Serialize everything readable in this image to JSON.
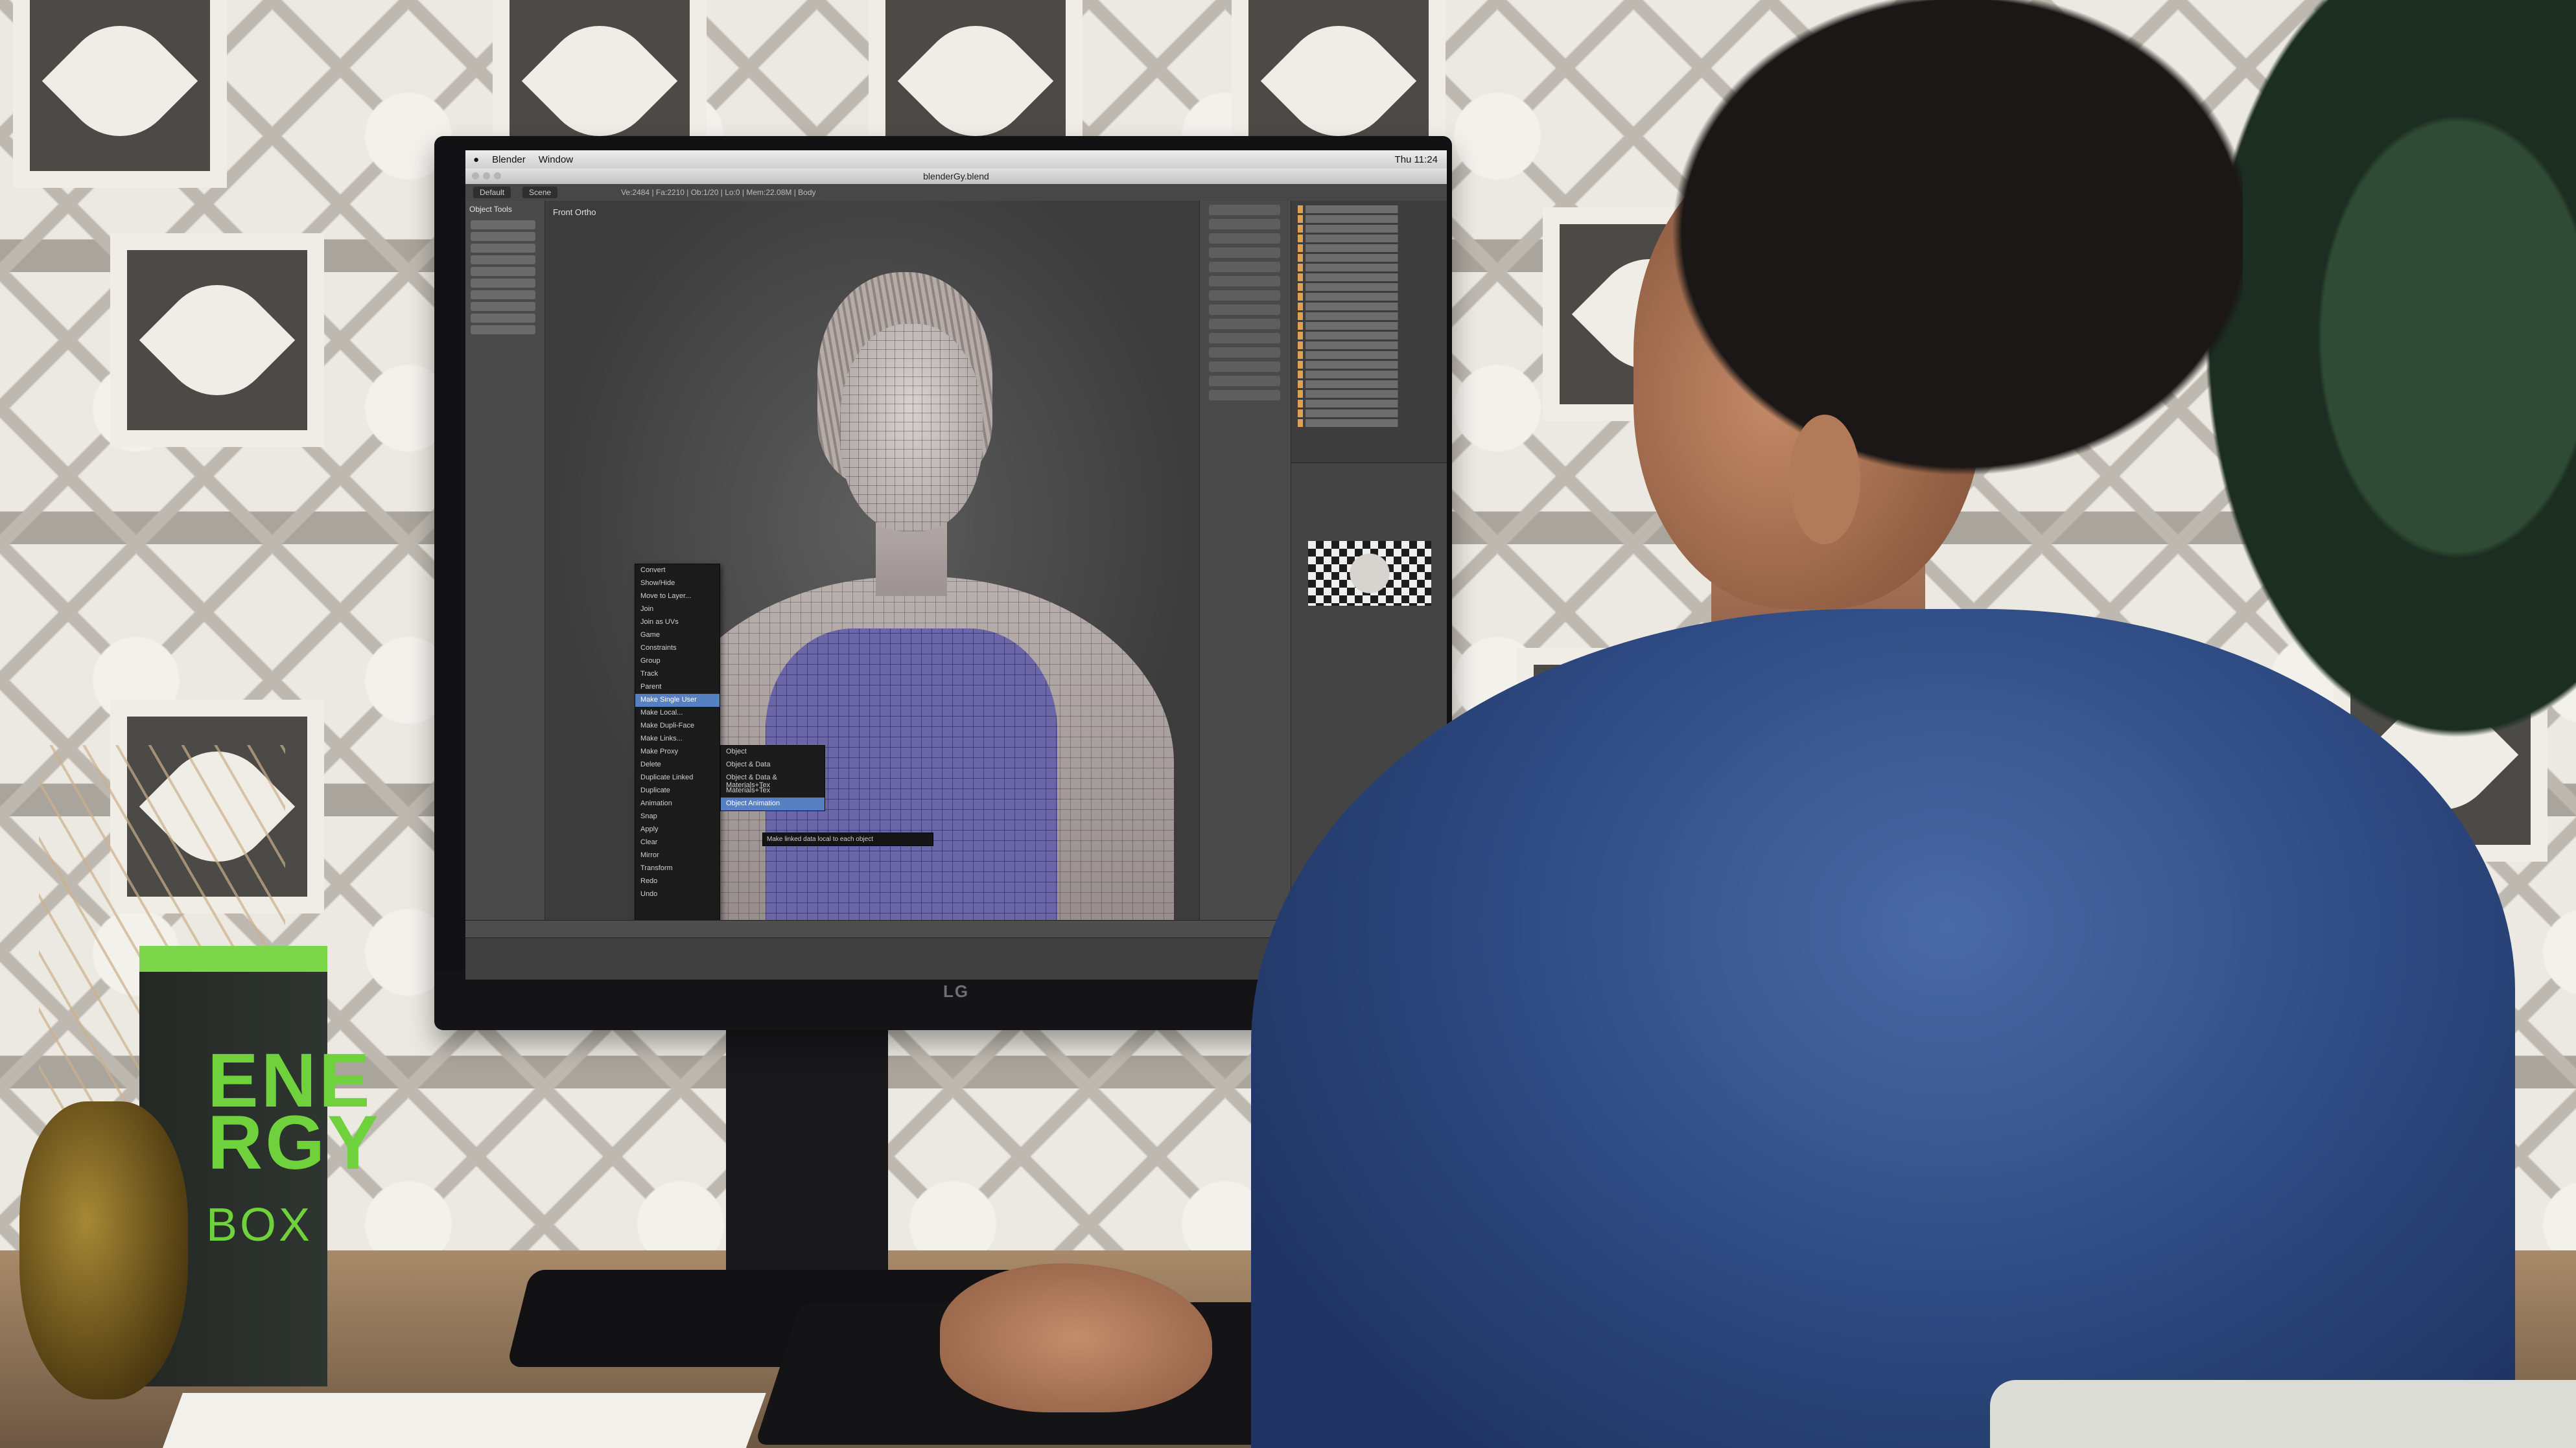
{
  "scene": {
    "description_label": "",
    "monitor": {
      "brand": "LG"
    },
    "product_box": {
      "line1": "ENE",
      "line2": "RGY",
      "line3": "BOX"
    }
  },
  "screen": {
    "menubar": {
      "apple": "",
      "app": "Blender",
      "window": "Window",
      "clock": "Thu 11:24"
    },
    "titlebar": {
      "title": "blenderGy.blend"
    },
    "info_header": {
      "layout": "Default",
      "scene": "Scene",
      "stats": "Ve:2484 | Fa:2210 | Ob:1/20 | Lo:0 | Mem:22.08M | Body"
    },
    "viewport": {
      "label": "Front Ortho"
    },
    "toolshelf": {
      "heading": "Object Tools"
    },
    "context_menu": {
      "items": [
        "Convert",
        "Show/Hide",
        "Move to Layer...",
        "Join",
        "Join as UVs",
        "Game",
        "Constraints",
        "Group",
        "Track",
        "Parent",
        "Make Single User",
        "Make Local...",
        "Make Dupli-Face",
        "Make Links...",
        "Make Proxy",
        "Delete",
        "Duplicate Linked",
        "Duplicate",
        "Animation",
        "Snap",
        "Apply",
        "Clear",
        "Mirror",
        "Transform",
        "Redo",
        "Undo"
      ],
      "selected": "Make Single User"
    },
    "submenu": {
      "items": [
        "Object",
        "Object & Data",
        "Object & Data & Materials+Tex",
        "Materials+Tex",
        "Object Animation"
      ],
      "selected": "Object Animation"
    },
    "tooltip": {
      "text": "Make linked data local to each object"
    }
  },
  "colors": {
    "accent": "#5680c2",
    "energy_green": "#6fd13c",
    "shirt_blue": "#2e4a82"
  }
}
